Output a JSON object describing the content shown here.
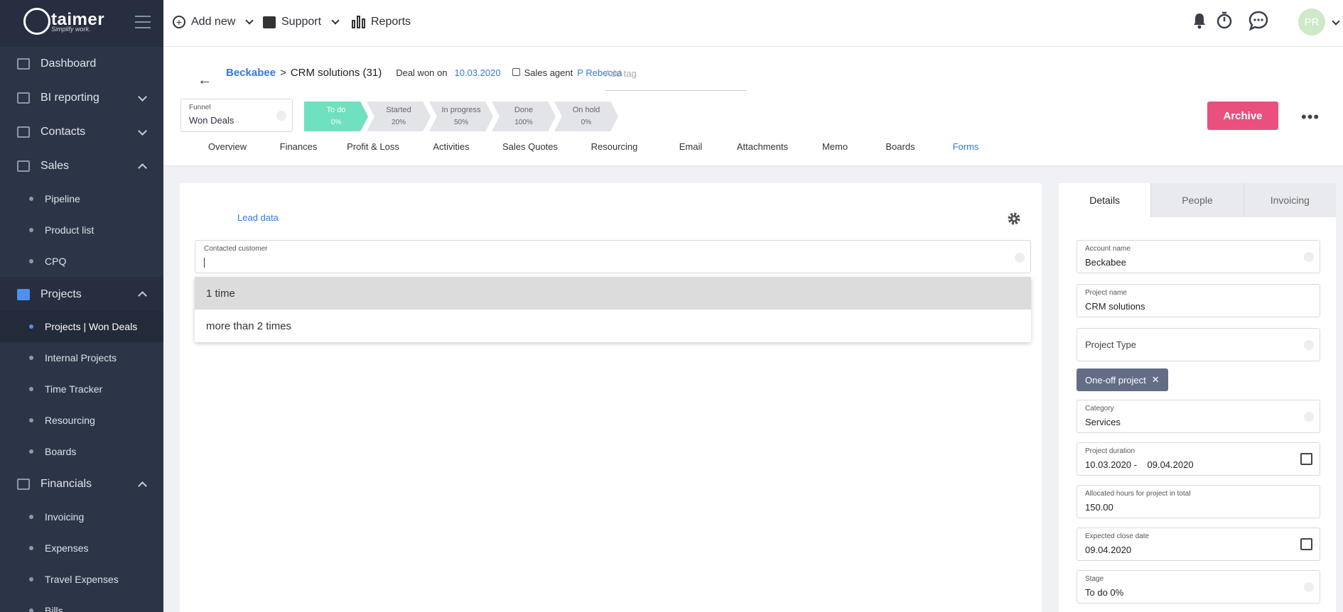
{
  "brand": {
    "name": "taimer",
    "tagline": "Simplify work."
  },
  "sidebar": {
    "dashboard": "Dashboard",
    "bi": "BI reporting",
    "contacts": "Contacts",
    "sales": "Sales",
    "sales_items": [
      "Pipeline",
      "Product list",
      "CPQ"
    ],
    "projects": "Projects",
    "project_items": [
      "Projects | Won Deals",
      "Internal Projects",
      "Time Tracker",
      "Resourcing",
      "Boards"
    ],
    "financials": "Financials",
    "financial_items": [
      "Invoicing",
      "Expenses",
      "Travel Expenses",
      "Bills"
    ]
  },
  "topbar": {
    "add_new": "Add new",
    "support": "Support",
    "reports": "Reports",
    "avatar": "PR",
    "icons": [
      "bell-icon",
      "timer-icon",
      "chat-icon"
    ]
  },
  "header": {
    "account": "Beckabee",
    "separator": ">",
    "project_title": "CRM solutions (31)",
    "deal_won_label": "Deal won on",
    "deal_won_date": "10.03.2020",
    "sales_agent_label": "Sales agent",
    "sales_agent": "P Rebecca",
    "add_tag": "Add tag",
    "funnel_label": "Funnel",
    "funnel_value": "Won Deals",
    "stages": [
      {
        "name": "To do",
        "pct": "0%"
      },
      {
        "name": "Started",
        "pct": "20%"
      },
      {
        "name": "In progress",
        "pct": "50%"
      },
      {
        "name": "Done",
        "pct": "100%"
      },
      {
        "name": "On hold",
        "pct": "0%"
      }
    ],
    "archive": "Archive",
    "more": "•••"
  },
  "tabs": [
    "Overview",
    "Finances",
    "Profit & Loss",
    "Activities",
    "Sales Quotes",
    "Resourcing",
    "Email",
    "Attachments",
    "Memo",
    "Boards",
    "Forms"
  ],
  "active_tab": "Forms",
  "form": {
    "tab": "Lead data",
    "field_label": "Contacted customer",
    "field_value": "",
    "options": [
      "1 time",
      "more than 2 times"
    ]
  },
  "details": {
    "tabs": [
      "Details",
      "People",
      "Invoicing"
    ],
    "account_name_label": "Account name",
    "account_name": "Beckabee",
    "project_name_label": "Project name",
    "project_name": "CRM solutions",
    "project_type_placeholder": "Project Type",
    "project_type_chip": "One-off project",
    "category_label": "Category",
    "category": "Services",
    "duration_label": "Project duration",
    "duration_start": "10.03.2020",
    "duration_sep": "-",
    "duration_end": "09.04.2020",
    "hours_label": "Allocated hours for project in total",
    "hours": "150.00",
    "close_label": "Expected close date",
    "close_date": "09.04.2020",
    "stage_label": "Stage",
    "stage": "To do 0%"
  },
  "colors": {
    "accent": "#2f7bde",
    "archive": "#e9507d",
    "stage_active": "#6fe0c0",
    "sidebar": "#2c3547"
  }
}
